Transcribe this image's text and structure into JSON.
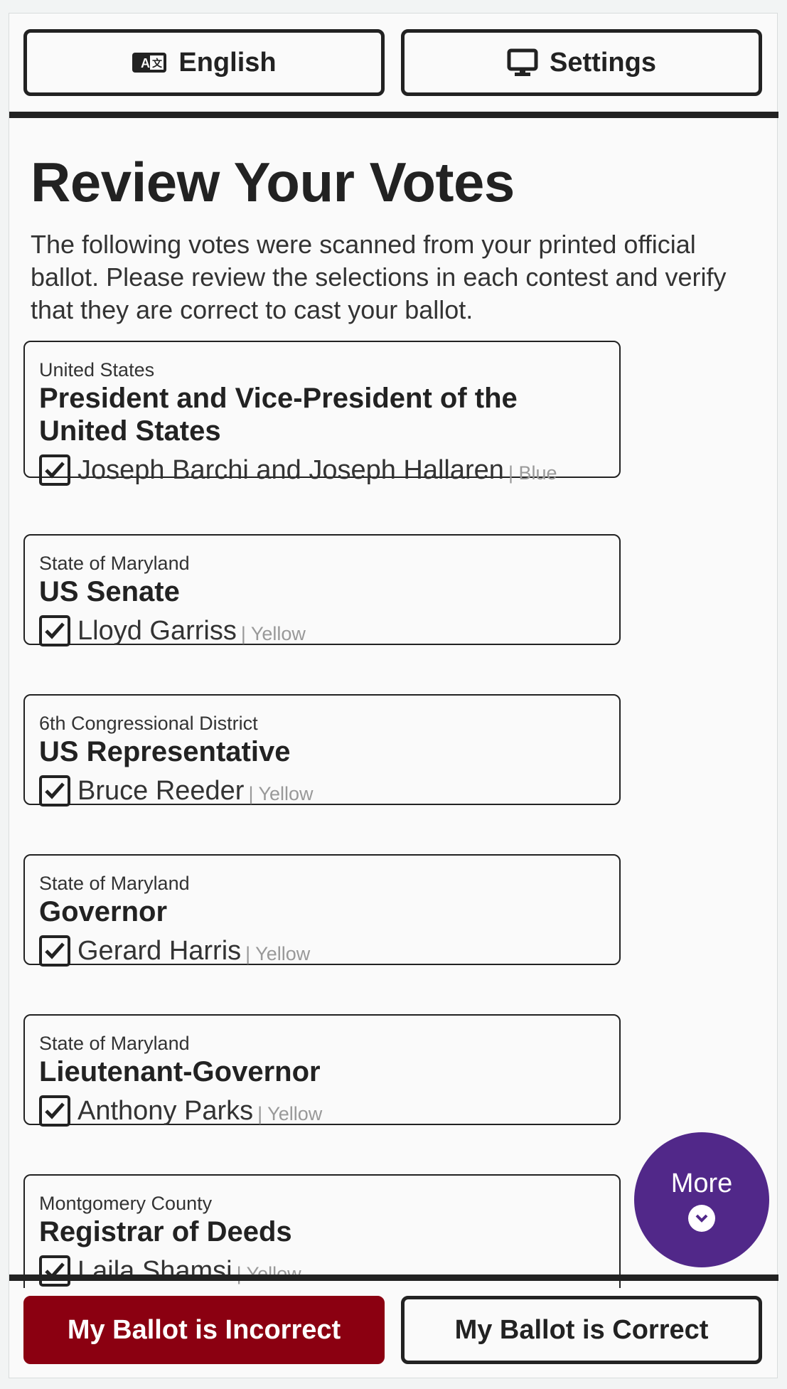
{
  "toolbar": {
    "language_label": "English",
    "settings_label": "Settings"
  },
  "page": {
    "title": "Review Your Votes",
    "intro": "The following votes were scanned from your printed official ballot. Please review the selections in each contest and verify that they are correct to cast your ballot."
  },
  "contests": [
    {
      "district": "United States",
      "title": "President and Vice-President of the United States",
      "candidate": "Joseph Barchi and Joseph Hallaren",
      "party": "| Blue"
    },
    {
      "district": "State of Maryland",
      "title": "US Senate",
      "candidate": "Lloyd Garriss",
      "party": "| Yellow"
    },
    {
      "district": "6th Congressional District",
      "title": "US Representative",
      "candidate": "Bruce Reeder",
      "party": "| Yellow"
    },
    {
      "district": "State of Maryland",
      "title": "Governor",
      "candidate": "Gerard Harris",
      "party": "| Yellow"
    },
    {
      "district": "State of Maryland",
      "title": "Lieutenant-Governor",
      "candidate": "Anthony Parks",
      "party": "| Yellow"
    },
    {
      "district": "Montgomery County",
      "title": "Registrar of Deeds",
      "candidate": "Laila Shamsi",
      "party": "| Yellow"
    }
  ],
  "more_button": {
    "label": "More",
    "icon": "chevron-down-icon",
    "color": "#512889"
  },
  "actions": {
    "incorrect_label": "My Ballot is Incorrect",
    "correct_label": "My Ballot is Correct",
    "incorrect_color": "#8b0011"
  },
  "icons": {
    "language": "language-icon",
    "settings": "monitor-icon",
    "checkbox": "checkbox-checked-icon"
  }
}
